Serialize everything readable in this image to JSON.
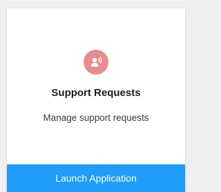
{
  "card": {
    "icon": "person-speaking-icon",
    "icon_color": "#e98c8f",
    "title": "Support Requests",
    "description": "Manage support requests",
    "button_label": "Launch Application",
    "button_color": "#1e9dfa"
  }
}
